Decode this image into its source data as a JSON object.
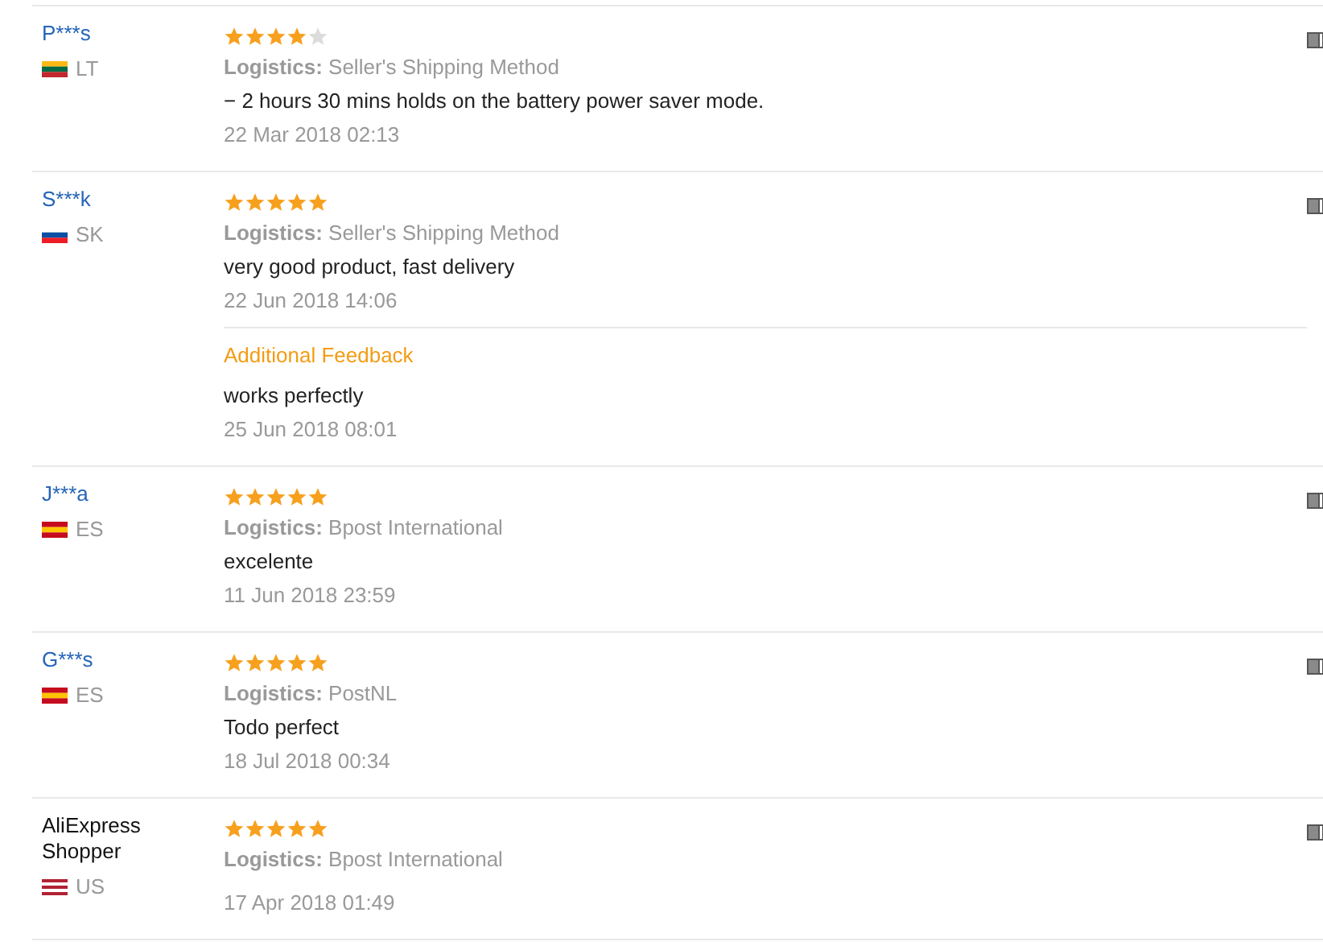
{
  "reviews": [
    {
      "name": "P***s",
      "link": true,
      "country": "LT",
      "flag_stripes": [
        {
          "color": "#fdb913"
        },
        {
          "color": "#006a44"
        },
        {
          "color": "#c1272d"
        }
      ],
      "stars": 4,
      "logistics_label": "Logistics:",
      "logistics": "Seller's Shipping Method",
      "comment": "− 2 hours 30 mins holds on the battery power saver mode.",
      "date": "22 Mar 2018 02:13"
    },
    {
      "name": "S***k",
      "link": true,
      "country": "SK",
      "flag_stripes": [
        {
          "color": "#ffffff"
        },
        {
          "color": "#0b4ea2"
        },
        {
          "color": "#ee1c25"
        }
      ],
      "stars": 5,
      "logistics_label": "Logistics:",
      "logistics": "Seller's Shipping Method",
      "comment": "very good product, fast delivery",
      "date": "22 Jun 2018 14:06",
      "additional": {
        "heading": "Additional Feedback",
        "comment": "works perfectly",
        "date": "25 Jun 2018 08:01"
      }
    },
    {
      "name": "J***a",
      "link": true,
      "country": "ES",
      "flag_stripes": [
        {
          "color": "#c60b1e"
        },
        {
          "color": "#ffc400"
        },
        {
          "color": "#c60b1e"
        }
      ],
      "stars": 5,
      "logistics_label": "Logistics:",
      "logistics": "Bpost International",
      "comment": "excelente",
      "date": "11 Jun 2018 23:59"
    },
    {
      "name": "G***s",
      "link": true,
      "country": "ES",
      "flag_stripes": [
        {
          "color": "#c60b1e"
        },
        {
          "color": "#ffc400"
        },
        {
          "color": "#c60b1e"
        }
      ],
      "stars": 5,
      "logistics_label": "Logistics:",
      "logistics": "PostNL",
      "comment": "Todo perfect",
      "date": "18 Jul 2018 00:34"
    },
    {
      "name": "AliExpress Shopper",
      "link": false,
      "country": "US",
      "flag_stripes": [
        {
          "color": "#b22234"
        },
        {
          "color": "#ffffff"
        },
        {
          "color": "#b22234"
        },
        {
          "color": "#ffffff"
        },
        {
          "color": "#b22234"
        }
      ],
      "stars": 5,
      "logistics_label": "Logistics:",
      "logistics": "Bpost International",
      "date": "17 Apr 2018 01:49"
    }
  ]
}
